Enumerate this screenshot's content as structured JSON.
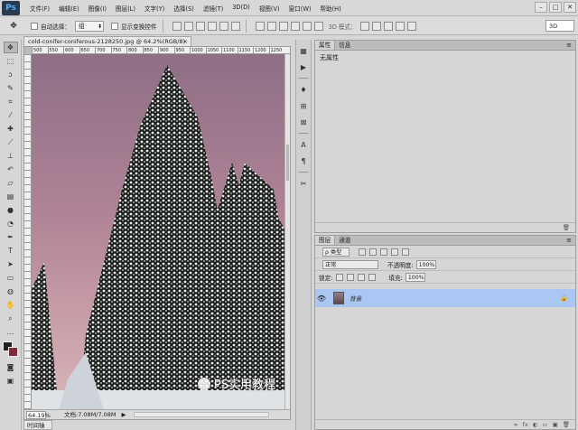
{
  "app": {
    "logo": "Ps"
  },
  "menu": [
    "文件(F)",
    "编辑(E)",
    "图像(I)",
    "图层(L)",
    "文字(Y)",
    "选择(S)",
    "滤镜(T)",
    "3D(D)",
    "视图(V)",
    "窗口(W)",
    "帮助(H)"
  ],
  "options": {
    "auto_select_label": "自动选择：",
    "auto_select_value": "组",
    "show_transform_label": "显示变换控件",
    "mode_3d_label": "3D 模式：",
    "workspace_value": "3D"
  },
  "document": {
    "tab_title": "cold-conifer-coniferous-2128250.jpg @ 64.2%(RGB/8)",
    "tab_close": "×",
    "ruler_marks": [
      "500",
      "550",
      "600",
      "650",
      "700",
      "750",
      "800",
      "850",
      "900",
      "950",
      "1000",
      "1050",
      "1100",
      "1150",
      "1200",
      "1250"
    ],
    "zoom": "64.19%",
    "doc_info": "文档:7.08M/7.08M",
    "arrow": "▶",
    "timeline_label": "时间轴"
  },
  "properties_panel": {
    "tabs": [
      "属性",
      "信息"
    ],
    "body_text": "无属性",
    "menu_icon": "≡"
  },
  "layers_panel": {
    "tabs": [
      "图层",
      "通道"
    ],
    "filter_label": "ρ 类型",
    "blend_mode": "正常",
    "opacity_label": "不透明度:",
    "opacity_value": "100%",
    "lock_label": "锁定:",
    "fill_label": "填充:",
    "fill_value": "100%",
    "layer_name": "背景",
    "footer_icons": [
      "fx",
      "◐",
      "▭",
      "▣",
      "🗑"
    ]
  },
  "watermark": "PS实用教程",
  "colors": {
    "foreground": "#222222",
    "background": "#7d2d3a",
    "selected_layer": "#a9c7f2"
  }
}
